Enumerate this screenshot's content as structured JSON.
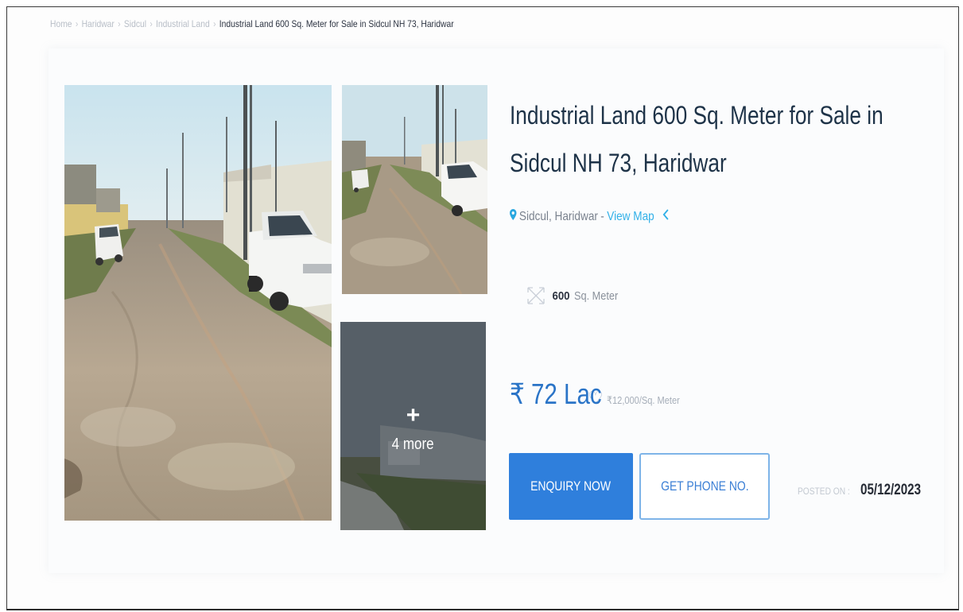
{
  "breadcrumb": {
    "items": [
      "Home",
      "Haridwar",
      "Sidcul",
      "Industrial Land"
    ],
    "current": "Industrial Land 600 Sq. Meter for Sale in Sidcul NH 73, Haridwar"
  },
  "gallery": {
    "more_label": "4 more",
    "more_icon": "plus-icon"
  },
  "listing": {
    "title": "Industrial Land 600 Sq. Meter for Sale in Sidcul NH 73, Haridwar",
    "location": "Sidcul, Haridwar",
    "view_map": "View Map",
    "area_value": "600",
    "area_unit": "Sq. Meter",
    "price": "₹ 72 Lac",
    "rate": "₹12,000/Sq. Meter",
    "enquiry_label": "ENQUIRY NOW",
    "phone_label": "GET PHONE NO.",
    "posted_label": "POSTED ON :",
    "posted_date": "05/12/2023"
  },
  "colors": {
    "accent": "#2f7fdc",
    "link": "#31b0e8",
    "title": "#1e3348"
  }
}
